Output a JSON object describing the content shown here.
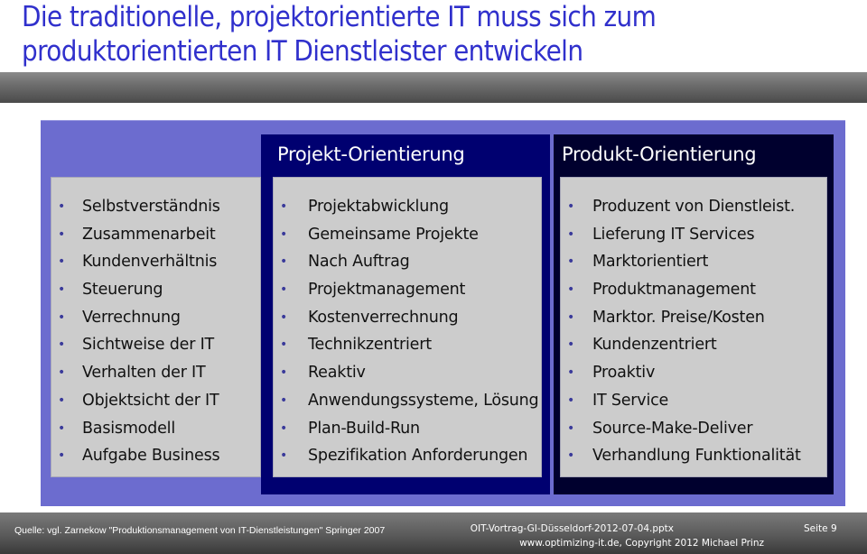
{
  "title": {
    "line1": "Die traditionelle, projektorientierte IT muss sich zum",
    "line2": "produktorientierten IT Dienstleister entwickeln"
  },
  "columns": {
    "criteria": {
      "header": "",
      "items": [
        "Selbstverständnis",
        "Zusammenarbeit",
        "Kundenverhältnis",
        "Steuerung",
        "Verrechnung",
        "Sichtweise der IT",
        "Verhalten der IT",
        "Objektsicht der IT",
        "Basismodell",
        "Aufgabe Business"
      ]
    },
    "project": {
      "header": "Projekt-Orientierung",
      "items": [
        "Projektabwicklung",
        "Gemeinsame Projekte",
        "Nach Auftrag",
        "Projektmanagement",
        "Kostenverrechnung",
        "Technikzentriert",
        "Reaktiv",
        "Anwendungssysteme, Lösung",
        "Plan-Build-Run",
        "Spezifikation Anforderungen"
      ]
    },
    "product": {
      "header": "Produkt-Orientierung",
      "items": [
        "Produzent von Dienstleist.",
        "Lieferung IT Services",
        "Marktorientiert",
        "Produktmanagement",
        "Marktor. Preise/Kosten",
        "Kundenzentriert",
        "Proaktiv",
        "IT Service",
        "Source-Make-Deliver",
        "Verhandlung Funktionalität"
      ]
    }
  },
  "bullet": "•",
  "footer": {
    "source": "Quelle: vgl. Zarnekow  \"Produktionsmanagement von IT-Dienstleistungen\" Springer 2007",
    "file": "OIT-Vortrag-GI-Düsseldorf-2012-07-04.pptx",
    "copyright": "www.optimizing-it.de, Copyright 2012 Michael Prinz",
    "page": "Seite 9"
  },
  "colors": {
    "title": "#3030cc",
    "outer_frame": "#6c6ccf",
    "project_column": "#000070",
    "product_column": "#00002e",
    "panel": "#cccccc"
  }
}
